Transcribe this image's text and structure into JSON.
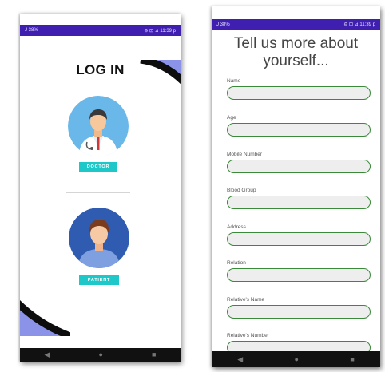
{
  "status_bar": {
    "carrier": "J 38%",
    "time": "⊖ ⊡ ⊿ 11:39 p"
  },
  "login_screen": {
    "title": "LOG IN",
    "doctor_button": "DOCTOR",
    "patient_button": "PATIENT",
    "colors": {
      "accent": "#1ec8c8",
      "status_bar": "#3f1fb0",
      "decoration": "#8b93e8"
    }
  },
  "nav_bar": {
    "back_icon": "back-triangle-icon",
    "home_icon": "home-circle-icon",
    "recents_icon": "recents-square-icon"
  },
  "register_screen": {
    "title": "Tell us more about yourself...",
    "fields": [
      {
        "label": "Name",
        "value": ""
      },
      {
        "label": "Age",
        "value": ""
      },
      {
        "label": "Mobile Number",
        "value": ""
      },
      {
        "label": "Blood Group",
        "value": ""
      },
      {
        "label": "Address",
        "value": ""
      },
      {
        "label": "Relation",
        "value": ""
      },
      {
        "label": "Relative's Name",
        "value": ""
      },
      {
        "label": "Relative's Number",
        "value": ""
      }
    ],
    "colors": {
      "input_border": "#3a8a3a",
      "input_fill": "#eeeeee"
    }
  }
}
